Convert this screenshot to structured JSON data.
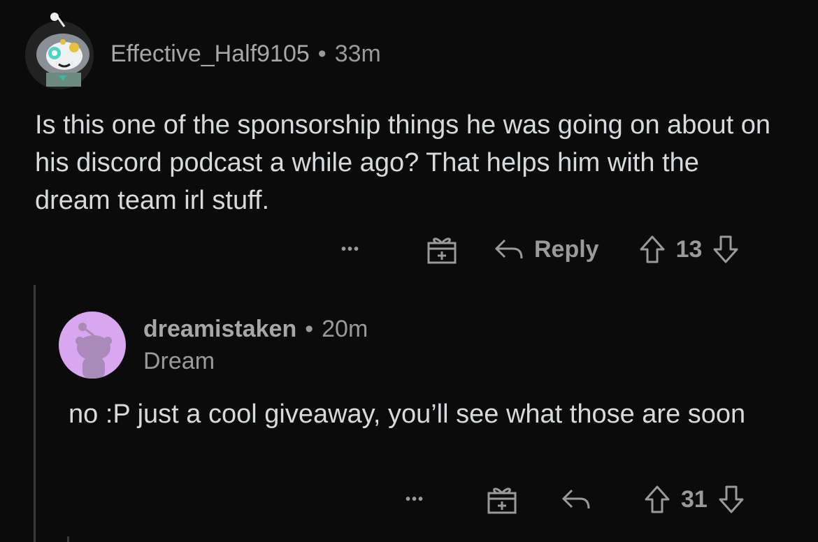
{
  "comments": [
    {
      "username": "Effective_Half9105",
      "separator": "•",
      "time": "33m",
      "text": "Is this one of the sponsorship things he was going on about on his discord podcast a while ago? That helps him with the dream team irl stuff.",
      "more": "•••",
      "reply_label": "Reply",
      "score": "13",
      "icons": [
        "more-icon",
        "award-icon",
        "reply-icon",
        "upvote-icon",
        "downvote-icon"
      ]
    },
    {
      "username": "dreamistaken",
      "separator": "•",
      "time": "20m",
      "flair": "Dream",
      "text": "no :P just a cool giveaway, you’ll see what those are soon",
      "more": "•••",
      "score": "31",
      "icons": [
        "more-icon",
        "award-icon",
        "reply-icon",
        "upvote-icon",
        "downvote-icon"
      ]
    }
  ],
  "colors": {
    "background": "#0b0b0b",
    "text": "#d7dadc",
    "muted": "#9a9a9a",
    "avatar2_bg": "#d8a7f0"
  }
}
